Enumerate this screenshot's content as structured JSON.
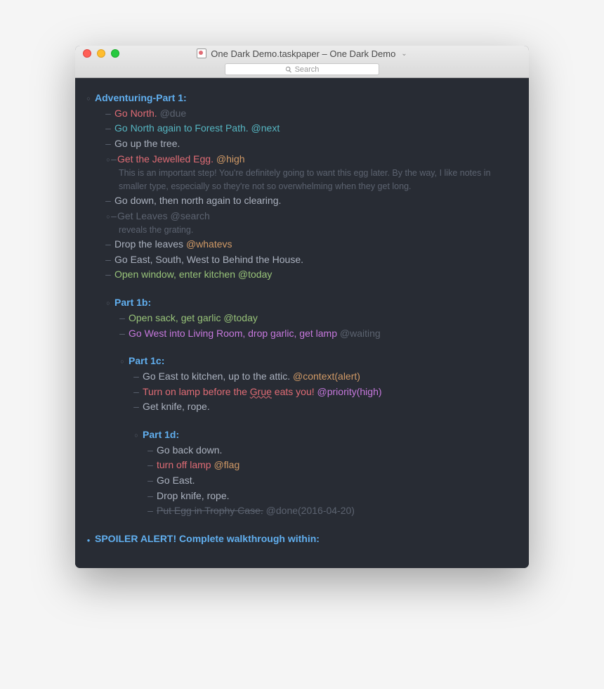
{
  "window": {
    "title": "One Dark Demo.taskpaper – One Dark Demo",
    "search_placeholder": "Search"
  },
  "projects": {
    "p1": {
      "title": "Adventuring-Part 1:",
      "t1": {
        "text": "Go North.",
        "tag": "@due"
      },
      "t2": {
        "text": "Go North again to Forest Path.",
        "tag": "@next"
      },
      "t3": {
        "text": "Go up the tree."
      },
      "t4": {
        "text": "Get the Jewelled Egg.",
        "tag": "@high",
        "note": "This is an important step! You're definitely going to want this egg later. By the way, I like notes in smaller type, especially so they're not so overwhelming when they get long."
      },
      "t5": {
        "text": "Go down, then north again to clearing."
      },
      "t6": {
        "text": "Get Leaves",
        "tag": "@search",
        "note": "reveals the grating."
      },
      "t7": {
        "text": "Drop the leaves",
        "tag": "@whatevs"
      },
      "t8": {
        "text": "Go East, South, West to Behind the House."
      },
      "t9": {
        "text": "Open window, enter kitchen",
        "tag": "@today"
      }
    },
    "p1b": {
      "title": "Part 1b:",
      "t1": {
        "text": "Open sack, get garlic",
        "tag": "@today"
      },
      "t2": {
        "text": "Go West into Living Room, drop garlic, get lamp",
        "tag": "@waiting"
      }
    },
    "p1c": {
      "title": "Part 1c:",
      "t1": {
        "text": "Go East to kitchen, up to the attic.",
        "tag": "@context(alert)"
      },
      "t2": {
        "pre": "Turn on lamp before the ",
        "grue": "Grue",
        "post": " eats you!",
        "tag": "@priority(high)"
      },
      "t3": {
        "text": "Get knife, rope."
      }
    },
    "p1d": {
      "title": "Part 1d:",
      "t1": {
        "text": "Go back down."
      },
      "t2": {
        "text": "turn off lamp",
        "tag": "@flag"
      },
      "t3": {
        "text": "Go East."
      },
      "t4": {
        "text": "Drop knife, rope."
      },
      "t5": {
        "text": "Put Egg in Trophy Case.",
        "tag": "@done(2016-04-20)"
      }
    },
    "spoiler": {
      "title": "SPOILER ALERT! Complete walkthrough within:"
    }
  }
}
